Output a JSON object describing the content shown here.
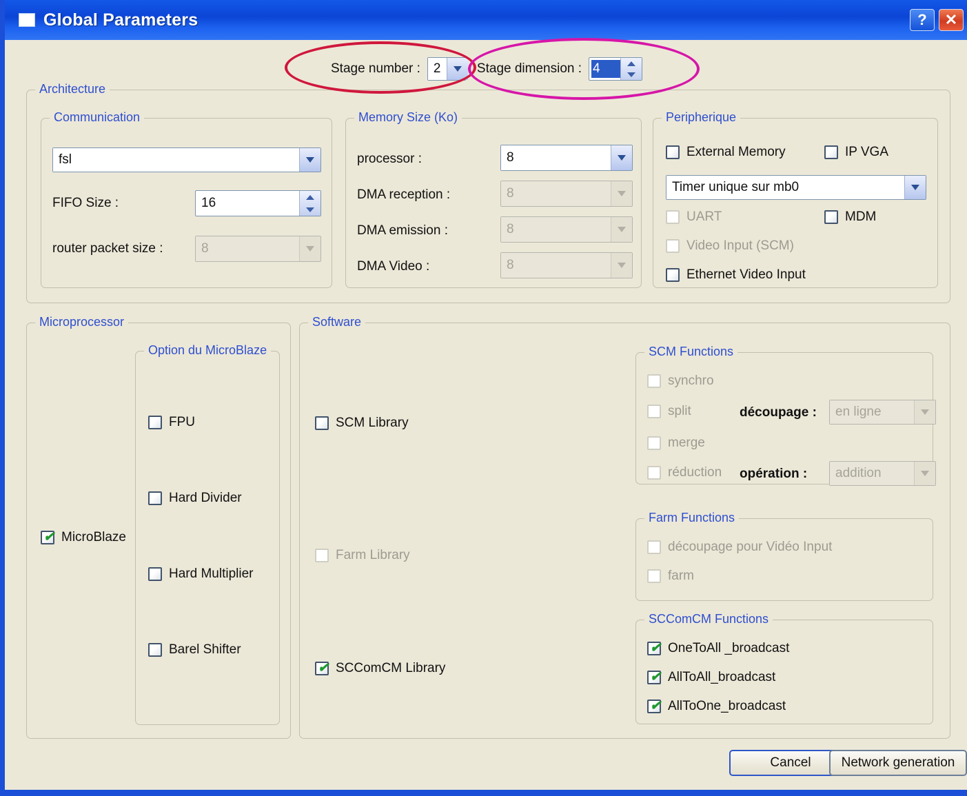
{
  "window": {
    "title": "Global Parameters",
    "help_button": "?",
    "close_button": "✕",
    "icon": "window-icon"
  },
  "top_row": {
    "stage_number_label": "Stage number :",
    "stage_number_value": "2",
    "stage_dimension_label": "Stage dimension :",
    "stage_dimension_value": "4"
  },
  "architecture": {
    "title": "Architecture",
    "communication": {
      "title": "Communication",
      "protocol_value": "fsl",
      "fifo_size_label": "FIFO Size :",
      "fifo_size_value": "16",
      "router_packet_label": "router packet size :",
      "router_packet_value": "8"
    },
    "memory": {
      "title": "Memory Size (Ko)",
      "rows": [
        {
          "label": "processor :",
          "value": "8",
          "disabled": false
        },
        {
          "label": "DMA reception :",
          "value": "8",
          "disabled": true
        },
        {
          "label": "DMA emission :",
          "value": "8",
          "disabled": true
        },
        {
          "label": "DMA Video :",
          "value": "8",
          "disabled": true
        }
      ]
    },
    "peripherique": {
      "title": "Peripherique",
      "external_memory": "External Memory",
      "ip_vga": "IP VGA",
      "timer_value": "Timer unique sur mb0",
      "uart": "UART",
      "mdm": "MDM",
      "video_input_scm": "Video Input (SCM)",
      "ethernet_video_input": "Ethernet Video Input"
    }
  },
  "microprocessor": {
    "title": "Microprocessor",
    "microblaze_label": "MicroBlaze",
    "options_title": "Option du MicroBlaze",
    "options": [
      "FPU",
      "Hard Divider",
      "Hard Multiplier",
      "Barel Shifter"
    ]
  },
  "software": {
    "title": "Software",
    "scm_library": "SCM Library",
    "farm_library": "Farm Library",
    "sccomcm_library": "SCComCM Library",
    "scm_functions": {
      "title": "SCM Functions",
      "synchro": "synchro",
      "split": "split",
      "decoupage_label": "découpage :",
      "decoupage_value": "en ligne",
      "merge": "merge",
      "reduction": "réduction",
      "operation_label": "opération :",
      "operation_value": "addition"
    },
    "farm_functions": {
      "title": "Farm Functions",
      "decoupage_video": "découpage pour Vidéo Input",
      "farm": "farm"
    },
    "sccomcm_functions": {
      "title": "SCComCM Functions",
      "items": [
        "OneToAll _broadcast",
        "AllToAll_broadcast",
        "AllToOne_broadcast"
      ]
    }
  },
  "footer": {
    "cancel": "Cancel",
    "network_generation": "Network generation"
  }
}
